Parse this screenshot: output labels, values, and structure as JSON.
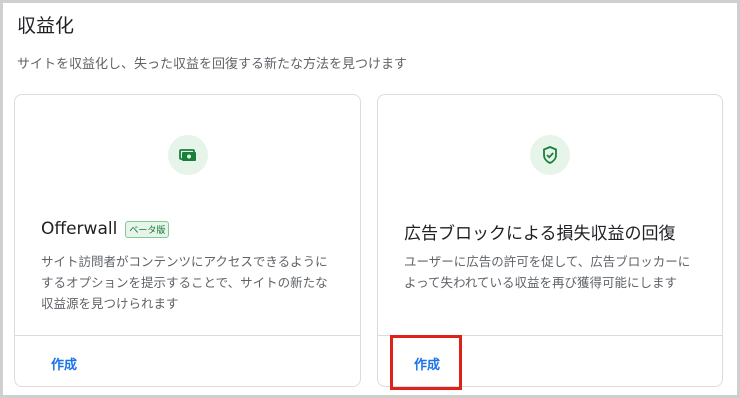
{
  "header": {
    "title": "収益化",
    "description": "サイトを収益化し、失った収益を回復する新たな方法を見つけます"
  },
  "cards": [
    {
      "icon": "cash-icon",
      "title": "Offerwall",
      "badge": "ベータ版",
      "description": "サイト訪問者がコンテンツにアクセスできるようにするオプションを提示することで、サイトの新たな収益源を見つけられます",
      "action_label": "作成"
    },
    {
      "icon": "shield-check-icon",
      "title": "広告ブロックによる損失収益の回復",
      "description": "ユーザーに広告の許可を促して、広告ブロッカーによって失われている収益を再び獲得可能にします",
      "action_label": "作成"
    }
  ],
  "colors": {
    "accent": "#1a73e8",
    "icon_bg": "#e6f4ea",
    "icon_fg": "#188038",
    "highlight": "#e0201b"
  }
}
